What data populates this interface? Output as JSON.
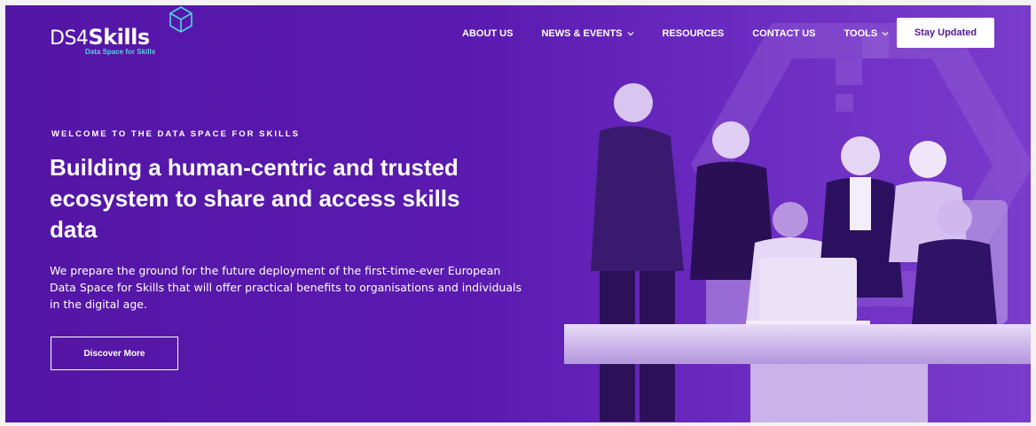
{
  "logo": {
    "brand_light": "DS4",
    "brand_bold": "Skills",
    "tagline": "Data Space for Skills",
    "icon": "cube-icon"
  },
  "nav": {
    "items": [
      {
        "label": "ABOUT US",
        "has_dropdown": false
      },
      {
        "label": "NEWS & EVENTS",
        "has_dropdown": true
      },
      {
        "label": "RESOURCES",
        "has_dropdown": false
      },
      {
        "label": "CONTACT US",
        "has_dropdown": false
      },
      {
        "label": "TOOLS",
        "has_dropdown": true
      }
    ],
    "cta_label": "Stay Updated"
  },
  "hero": {
    "eyebrow": "WELCOME TO THE DATA SPACE FOR SKILLS",
    "headline": "Building a human-centric and trusted ecosystem to share and access skills data",
    "body": "We prepare the ground for the future deployment of the first-time-ever European Data Space for Skills that will offer practical benefits to organisations and individuals in the digital age.",
    "cta_label": "Discover More"
  },
  "colors": {
    "primary": "#5416a6",
    "accent": "#4fd6e0",
    "text": "#ffffff"
  }
}
